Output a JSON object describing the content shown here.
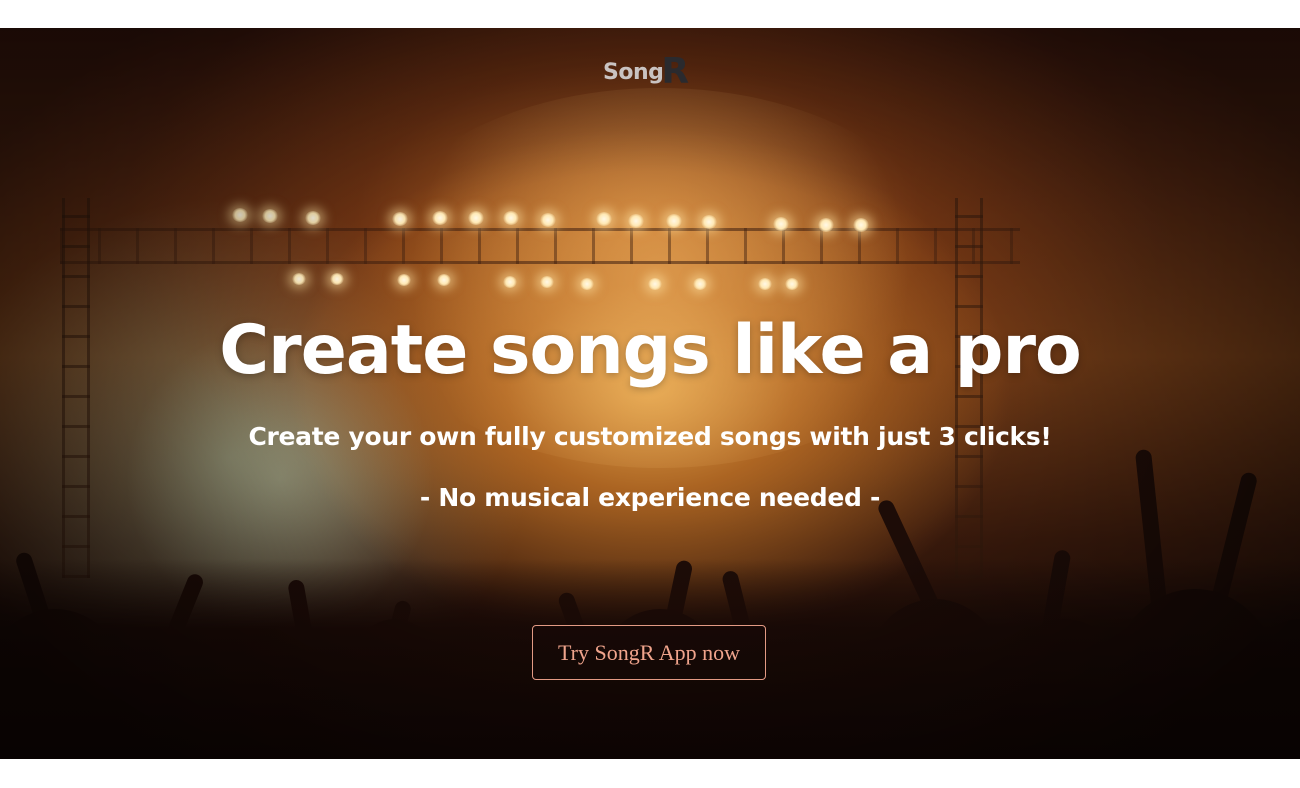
{
  "brand": {
    "logo_text": "Song",
    "logo_mark": "R"
  },
  "hero": {
    "headline": "Create songs like a pro",
    "subheadline": "Create your own fully customized songs with just 3 clicks!",
    "tagline": "- No musical experience needed -",
    "cta_label": "Try SongR App now"
  },
  "colors": {
    "cta_border": "#e39a84",
    "cta_text": "#f0a48c",
    "text": "#ffffff",
    "logo_text": "#c9c3c2",
    "logo_mark": "#2a2a2e"
  }
}
